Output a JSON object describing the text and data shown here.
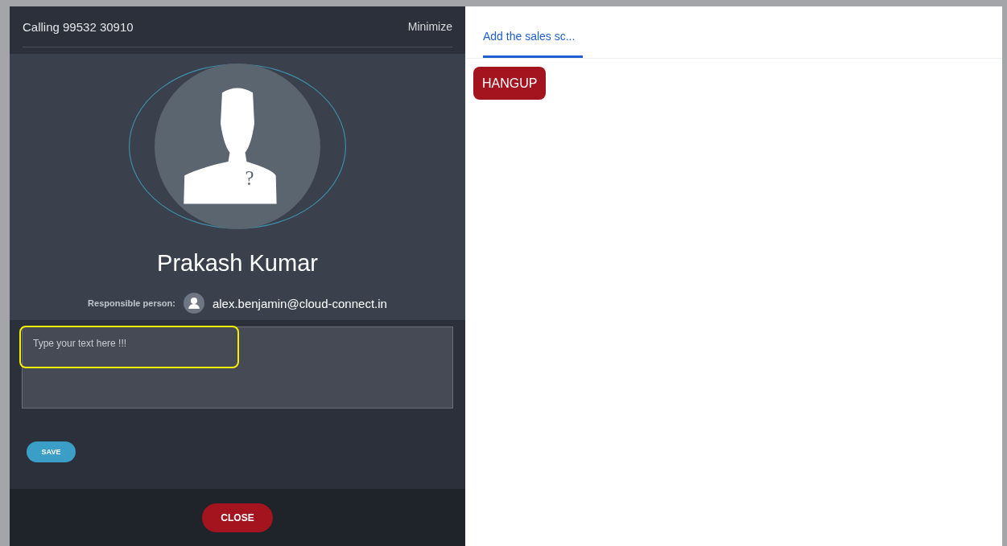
{
  "call_panel": {
    "title": "Calling 99532 30910",
    "minimize": "Minimize",
    "avatar_mark": "?",
    "contact_name": "Prakash Kumar",
    "responsible_label": "Responsible person:",
    "responsible_email": "alex.benjamin@cloud-connect.in",
    "note": {
      "value": "Type your text here !!!",
      "highlighted": true
    },
    "save": "SAVE",
    "close": "CLOSE"
  },
  "script_panel": {
    "tabs": [
      {
        "label": "Add the sales sc...",
        "selected": true
      }
    ],
    "hangup": "HANGUP"
  }
}
